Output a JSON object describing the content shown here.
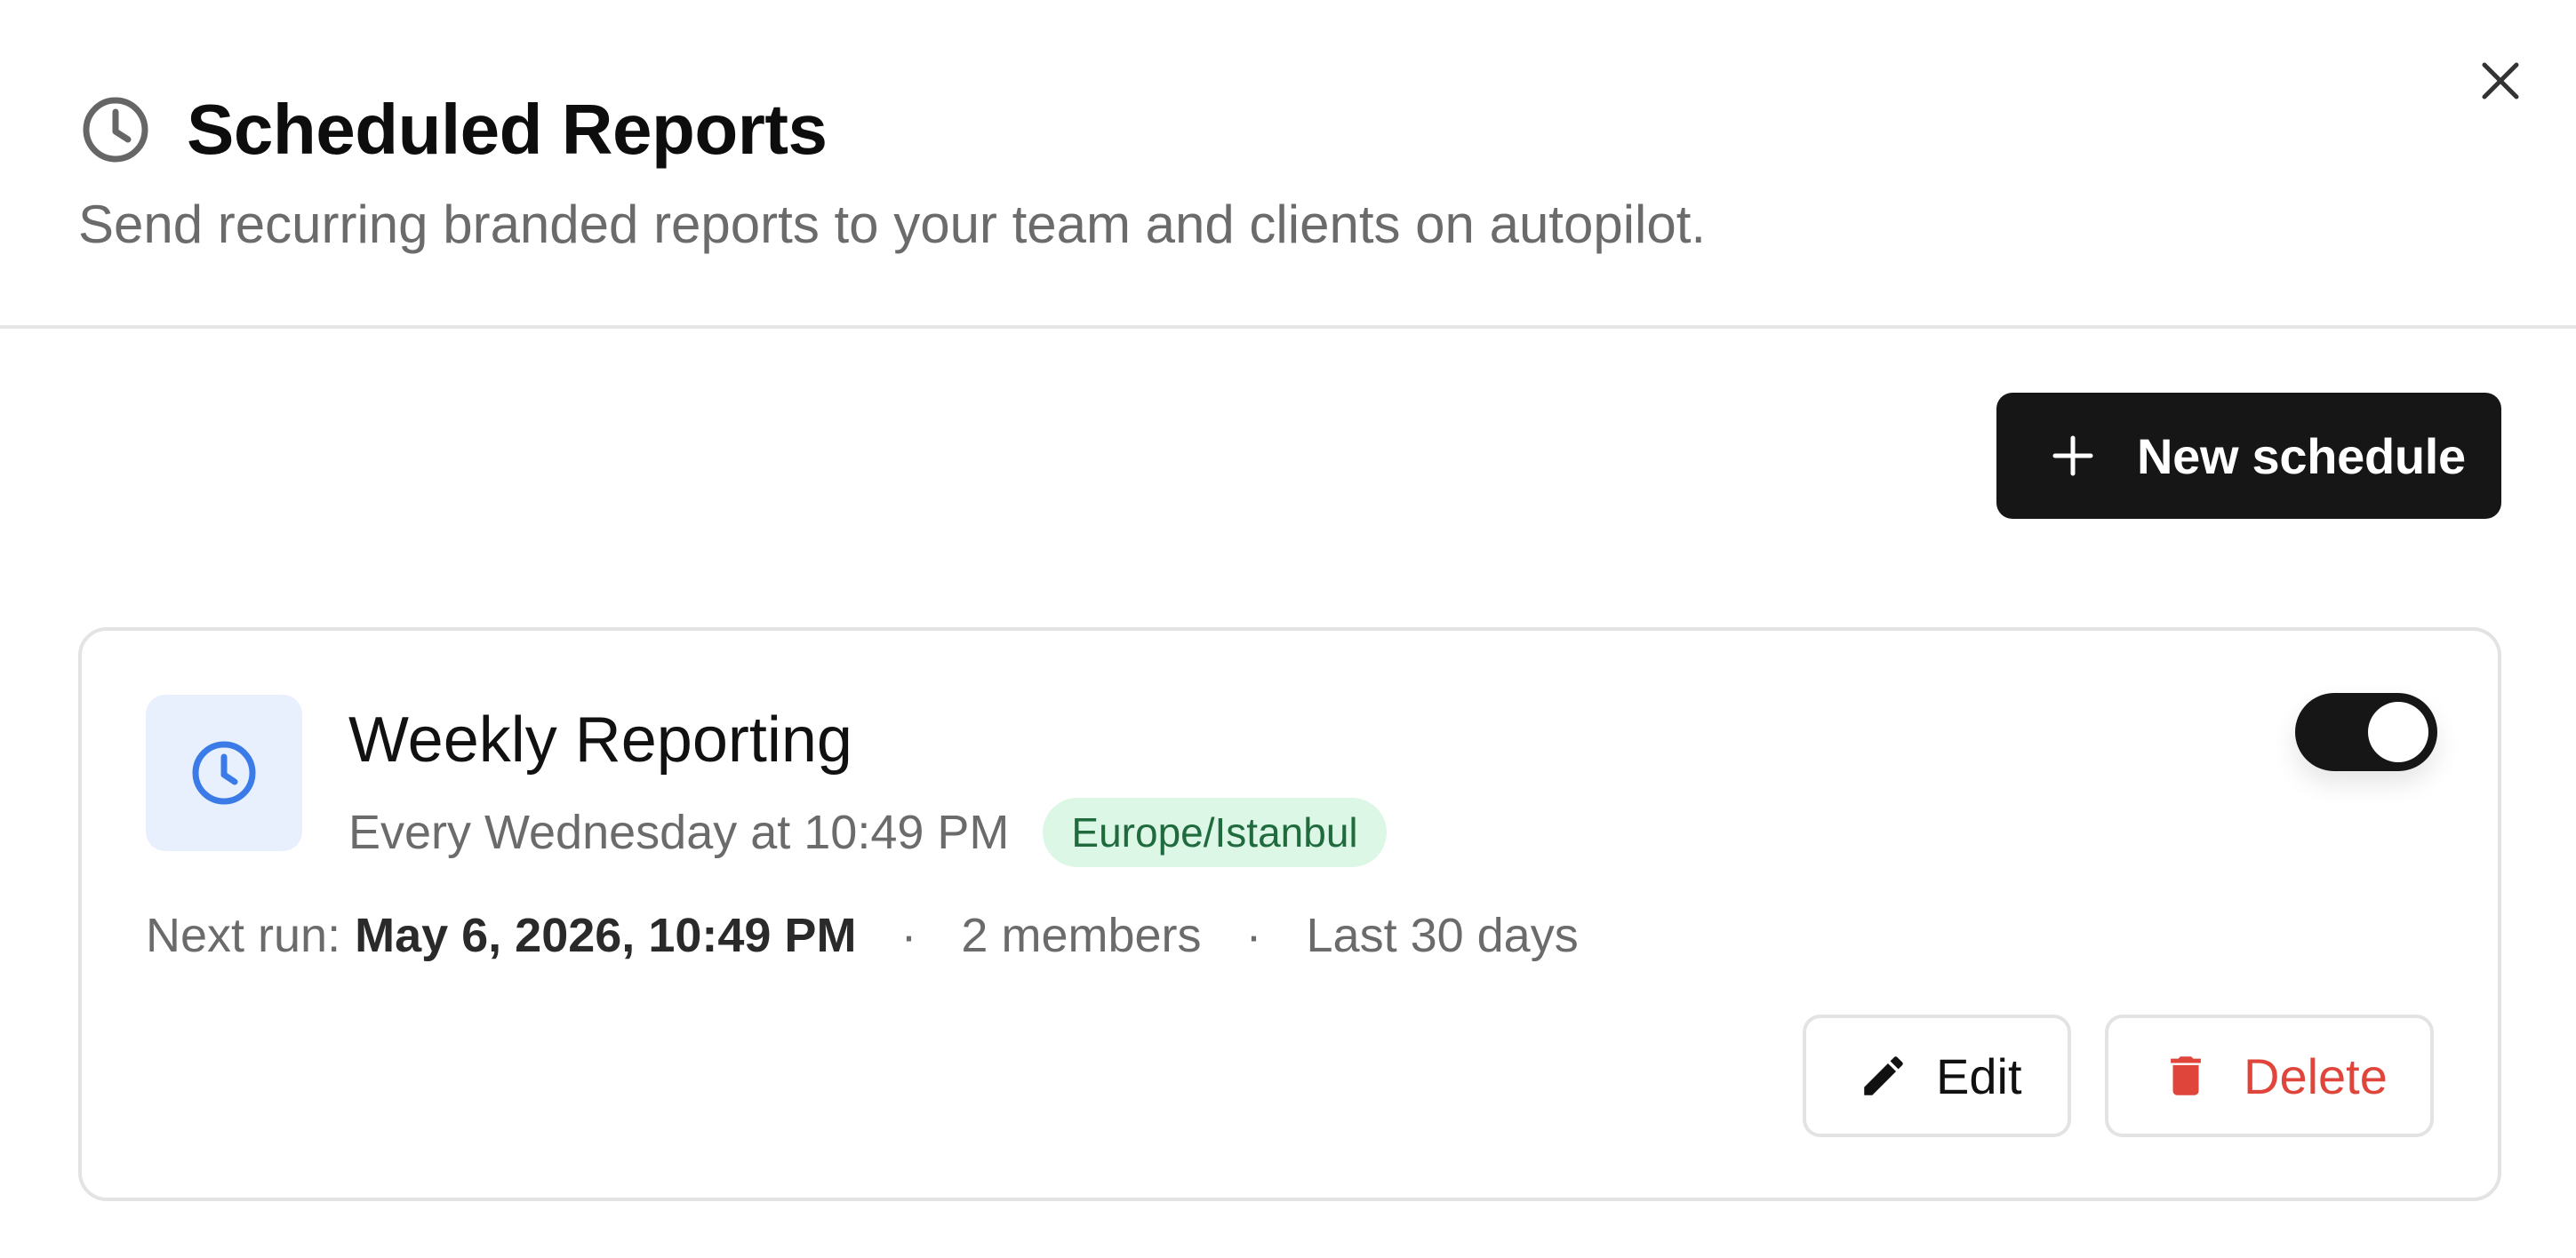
{
  "header": {
    "title": "Scheduled Reports",
    "subtitle": "Send recurring branded reports to your team and clients on autopilot.",
    "title_icon": "clock-icon",
    "close_icon": "close-icon"
  },
  "toolbar": {
    "new_schedule_label": "New schedule",
    "new_schedule_icon": "plus-icon"
  },
  "schedules": [
    {
      "name": "Weekly Reporting",
      "frequency": "Every Wednesday at 10:49 PM",
      "timezone": "Europe/Istanbul",
      "enabled": true,
      "next_run_label": "Next run:",
      "next_run_value": "May 6, 2026, 10:49 PM",
      "separator": "·",
      "members": "2 members",
      "range": "Last 30 days",
      "edit_label": "Edit",
      "delete_label": "Delete",
      "icon": "clock-icon"
    }
  ],
  "colors": {
    "primary_button": "#161616",
    "accent_blue": "#3b7be8",
    "icon_bg": "#e8effd",
    "badge_bg": "#dcf7e6",
    "badge_text": "#1f6b3e",
    "danger": "#e0453c",
    "muted_text": "#6b6b6b"
  }
}
